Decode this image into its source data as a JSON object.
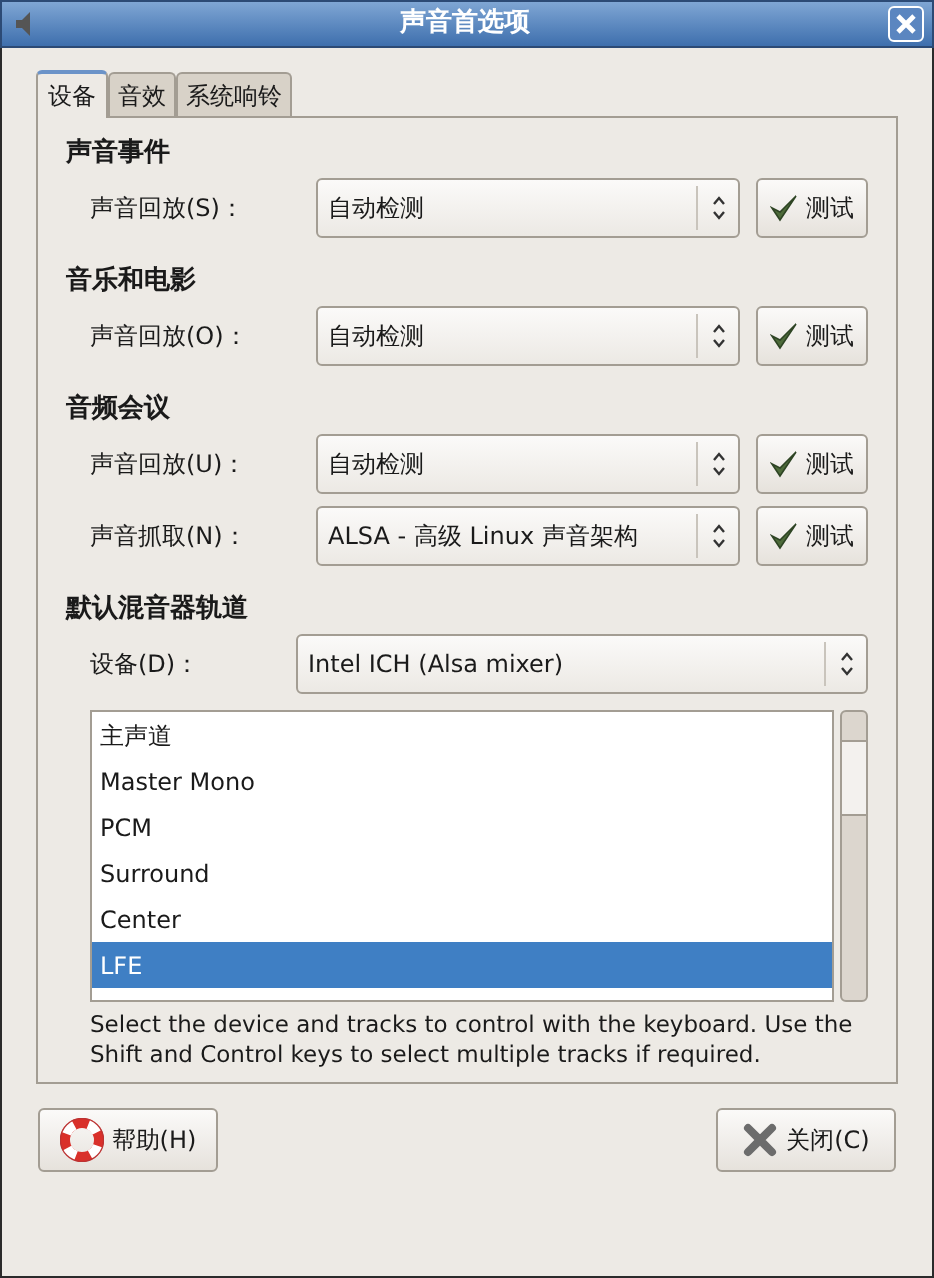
{
  "window": {
    "title": "声音首选项"
  },
  "tabs": [
    {
      "label": "设备",
      "selected": true
    },
    {
      "label": "音效",
      "selected": false
    },
    {
      "label": "系统响铃",
      "selected": false
    }
  ],
  "sections": [
    {
      "heading": "声音事件",
      "rows": [
        {
          "label": "声音回放(S)：",
          "value": "自动检测",
          "button": "测试"
        }
      ]
    },
    {
      "heading": "音乐和电影",
      "rows": [
        {
          "label": "声音回放(O)：",
          "value": "自动检测",
          "button": "测试"
        }
      ]
    },
    {
      "heading": "音频会议",
      "rows": [
        {
          "label": "声音回放(U)：",
          "value": "自动检测",
          "button": "测试"
        },
        {
          "label": "声音抓取(N)：",
          "value": "ALSA - 高级 Linux 声音架构",
          "button": "测试"
        }
      ]
    }
  ],
  "mixer": {
    "heading": "默认混音器轨道",
    "device_label": "设备(D)：",
    "device_value": "Intel ICH (Alsa mixer)",
    "tracks": [
      {
        "label": "主声道",
        "selected": false
      },
      {
        "label": "Master Mono",
        "selected": false
      },
      {
        "label": "PCM",
        "selected": false
      },
      {
        "label": "Surround",
        "selected": false
      },
      {
        "label": "Center",
        "selected": false
      },
      {
        "label": "LFE",
        "selected": true
      }
    ],
    "hint": "Select the device and tracks to control with the keyboard. Use the Shift and Control keys to select multiple tracks if required."
  },
  "buttons": [
    {
      "kind": "help",
      "label": "帮助(H)"
    },
    {
      "kind": "close",
      "label": "关闭(C)"
    }
  ]
}
